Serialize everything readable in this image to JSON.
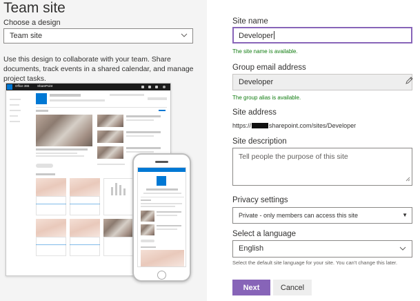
{
  "left_panel": {
    "title": "Team site",
    "choose_design_label": "Choose a design",
    "design_select_value": "Team site",
    "description": "Use this design to collaborate with your team. Share documents, track events in a shared calendar, and manage project tasks.",
    "preview": {
      "topbar_app": "Office 365",
      "topbar_product": "SharePoint"
    }
  },
  "form": {
    "site_name": {
      "label": "Site name",
      "value": "Developer",
      "validation": "The site name is available."
    },
    "group_email": {
      "label": "Group email address",
      "value": "Developer",
      "validation": "The group alias is available.",
      "edit_icon": "pencil-icon"
    },
    "site_address": {
      "label": "Site address",
      "prefix": "https://",
      "suffix": "sharepoint.com/sites/Developer"
    },
    "site_description": {
      "label": "Site description",
      "placeholder": "Tell people the purpose of this site"
    },
    "privacy": {
      "label": "Privacy settings",
      "value": "Private - only members can access this site"
    },
    "language": {
      "label": "Select a language",
      "value": "English",
      "hint": "Select the default site language for your site. You can't change this later."
    },
    "buttons": {
      "next": "Next",
      "cancel": "Cancel"
    }
  },
  "colors": {
    "accent": "#8764b8",
    "success": "#107c10",
    "sharepoint_blue": "#0078d4",
    "left_panel_bg": "#f4f4f4"
  }
}
